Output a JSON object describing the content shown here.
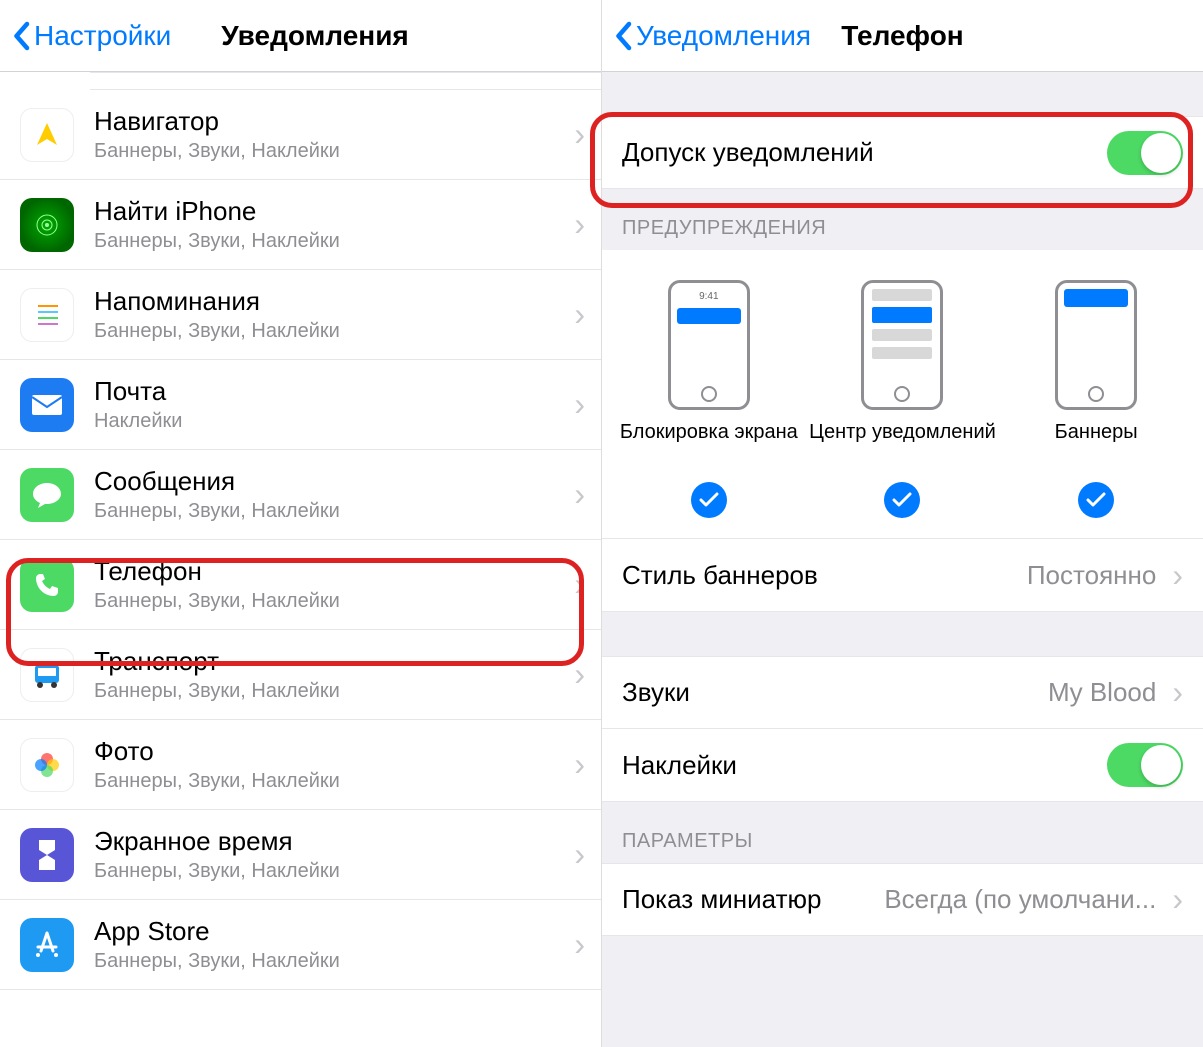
{
  "left": {
    "back_label": "Настройки",
    "title": "Уведомления",
    "apps": [
      {
        "name": "Навигатор",
        "sub": "Баннеры, Звуки, Наклейки",
        "icon": "navigator"
      },
      {
        "name": "Найти iPhone",
        "sub": "Баннеры, Звуки, Наклейки",
        "icon": "find-iphone"
      },
      {
        "name": "Напоминания",
        "sub": "Баннеры, Звуки, Наклейки",
        "icon": "reminders"
      },
      {
        "name": "Почта",
        "sub": "Наклейки",
        "icon": "mail"
      },
      {
        "name": "Сообщения",
        "sub": "Баннеры, Звуки, Наклейки",
        "icon": "messages"
      },
      {
        "name": "Телефон",
        "sub": "Баннеры, Звуки, Наклейки",
        "icon": "phone"
      },
      {
        "name": "Транспорт",
        "sub": "Баннеры, Звуки, Наклейки",
        "icon": "transport"
      },
      {
        "name": "Фото",
        "sub": "Баннеры, Звуки, Наклейки",
        "icon": "photos"
      },
      {
        "name": "Экранное время",
        "sub": "Баннеры, Звуки, Наклейки",
        "icon": "screen-time"
      },
      {
        "name": "App Store",
        "sub": "Баннеры, Звуки, Наклейки",
        "icon": "app-store"
      }
    ]
  },
  "right": {
    "back_label": "Уведомления",
    "title": "Телефон",
    "allow_label": "Допуск уведомлений",
    "allow_on": true,
    "alerts_header": "ПРЕДУПРЕЖДЕНИЯ",
    "alert_types": [
      {
        "label": "Блокировка экрана",
        "checked": true,
        "time": "9:41"
      },
      {
        "label": "Центр уведомлений",
        "checked": true
      },
      {
        "label": "Баннеры",
        "checked": true
      }
    ],
    "banner_style_label": "Стиль баннеров",
    "banner_style_value": "Постоянно",
    "sounds_label": "Звуки",
    "sounds_value": "My Blood",
    "badges_label": "Наклейки",
    "badges_on": true,
    "params_header": "ПАРАМЕТРЫ",
    "preview_label": "Показ миниатюр",
    "preview_value": "Всегда (по умолчани..."
  }
}
